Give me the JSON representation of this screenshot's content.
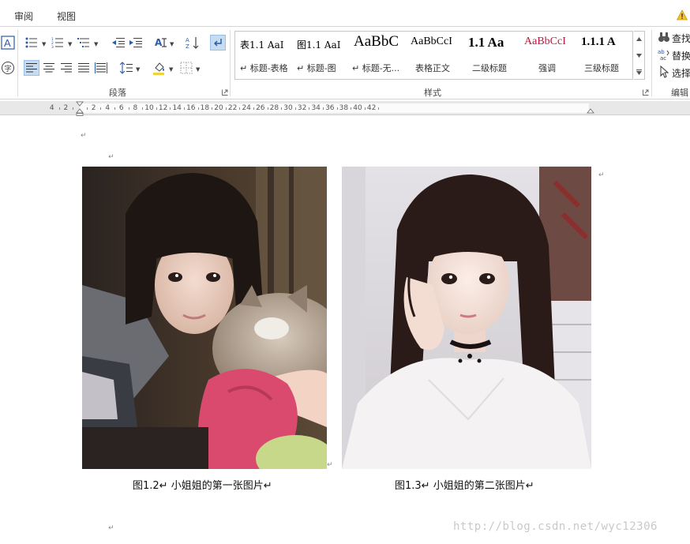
{
  "tabs": [
    {
      "label": "审阅"
    },
    {
      "label": "视图"
    }
  ],
  "ribbon": {
    "groups": {
      "paragraph": "段落",
      "styles": "样式",
      "editing": "编辑"
    },
    "styles_gallery": [
      {
        "sample": "表1.1  AaI",
        "name": "↵ 标题-表格"
      },
      {
        "sample": "图1.1  AaI",
        "name": "↵ 标题-图"
      },
      {
        "sample": "AaBbC",
        "name": "↵ 标题-无..."
      },
      {
        "sample": "AaBbCcI",
        "name": "表格正文"
      },
      {
        "sample": "1.1  Aa",
        "name": "二级标题"
      },
      {
        "sample": "AaBbCcI",
        "name": "强调"
      },
      {
        "sample": "1.1.1  A",
        "name": "三级标题"
      }
    ],
    "editing": {
      "find": "查找",
      "replace": "替换",
      "select": "选择"
    },
    "colors": {
      "emphasis_red": "#c0143c",
      "active_blue": "#c5dcf2"
    }
  },
  "ruler": {
    "labels": [
      "4",
      "2",
      "",
      "2",
      "4",
      "6",
      "8",
      "10",
      "12",
      "14",
      "16",
      "18",
      "20",
      "22",
      "24",
      "26",
      "28",
      "30",
      "32",
      "34",
      "36",
      "38",
      "40",
      "42"
    ]
  },
  "document": {
    "paragraph_mark": "↵",
    "captions": [
      "图1.2↵ 小姐姐的第一张图片↵",
      "图1.3↵ 小姐姐的第二张图片↵"
    ],
    "watermark": "http://blog.csdn.net/wyc12306"
  }
}
